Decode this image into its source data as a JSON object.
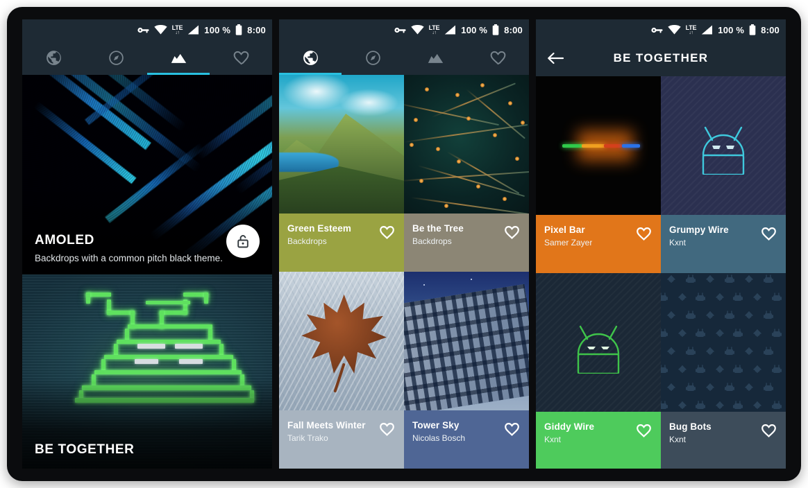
{
  "app": {
    "statusbar": {
      "icons": [
        "key-icon",
        "wifi-icon",
        "lte-icon",
        "signal-icon",
        "battery-icon"
      ],
      "lte_label": "LTE",
      "data_arrows": "↓↑",
      "battery_label": "100 %",
      "clock": "8:00"
    },
    "colors": {
      "chrome": "#1e2a34",
      "accent": "#29c0e0",
      "tab_inactive": "#78848d",
      "tab_active": "#ffffff"
    },
    "tabs": [
      {
        "label": "Home",
        "icon": "globe-icon",
        "active_panel1": false,
        "active_panel2": true
      },
      {
        "label": "Explore",
        "icon": "compass-icon",
        "active_panel1": false,
        "active_panel2": false
      },
      {
        "label": "Collections",
        "icon": "mountains-icon",
        "active_panel1": true,
        "active_panel2": false
      },
      {
        "label": "Favorites",
        "icon": "heart-icon",
        "active_panel1": false,
        "active_panel2": false
      }
    ]
  },
  "panel1": {
    "name": "collections-screen",
    "active_tab_index": 2,
    "cards": [
      {
        "title": "AMOLED",
        "subtitle": "Backdrops with a common pitch black theme.",
        "fab_icon": "lock-open-icon",
        "art": "amoled-chevron"
      },
      {
        "title": "BE TOGETHER",
        "subtitle": "",
        "art": "neon-pagoda"
      }
    ]
  },
  "panel2": {
    "name": "wallpapers-grid-screen",
    "active_tab_index": 0,
    "items": [
      {
        "title": "Green Esteem",
        "author": "Backdrops",
        "bar_color": "#9aa342",
        "art": "mountain-lake",
        "favorite_icon": "heart-icon"
      },
      {
        "title": "Be the Tree",
        "author": "Backdrops",
        "bar_color": "#8c8675",
        "art": "night-branches",
        "favorite_icon": "heart-icon"
      },
      {
        "title": "Fall Meets Winter",
        "author": "Tarik Trako",
        "bar_color": "#a8b4c0",
        "art": "maple-on-snow",
        "favorite_icon": "heart-icon"
      },
      {
        "title": "Tower Sky",
        "author": "Nicolas Bosch",
        "bar_color": "#4f6695",
        "art": "tower-night-sky",
        "favorite_icon": "heart-icon"
      }
    ]
  },
  "panel3": {
    "name": "collection-detail-screen",
    "back_icon": "arrow-left-icon",
    "title": "BE TOGETHER",
    "items": [
      {
        "title": "Pixel Bar",
        "author": "Samer Zayer",
        "bar_color": "#e1761a",
        "art": "pixel-bar",
        "favorite_icon": "heart-icon"
      },
      {
        "title": "Grumpy Wire",
        "author": "Kxnt",
        "bar_color": "#41697f",
        "art": "grumpy-droid",
        "favorite_icon": "heart-icon"
      },
      {
        "title": "Giddy Wire",
        "author": "Kxnt",
        "bar_color": "#4ecb5c",
        "art": "giddy-droid",
        "favorite_icon": "heart-icon"
      },
      {
        "title": "Bug Bots",
        "author": "Kxnt",
        "bar_color": "#3d4c5a",
        "art": "bug-pattern",
        "favorite_icon": "heart-icon"
      }
    ]
  }
}
